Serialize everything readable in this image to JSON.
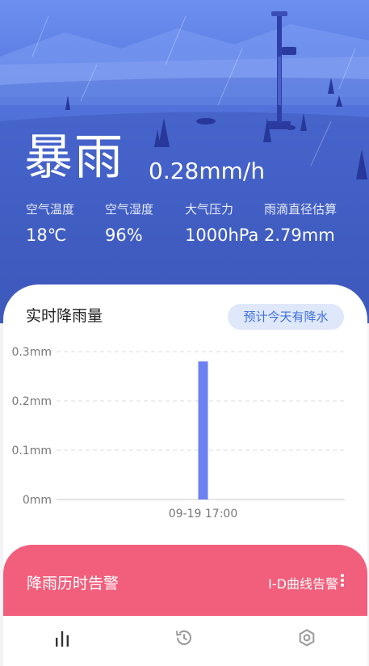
{
  "hero": {
    "weather_title": "暴雨",
    "rain_rate": "0.28mm/h",
    "stats": [
      {
        "label": "空气温度",
        "value": "18℃"
      },
      {
        "label": "空气湿度",
        "value": "96%"
      },
      {
        "label": "大气压力",
        "value": "1000hPa"
      },
      {
        "label": "雨滴直径估算",
        "value": "2.79mm"
      }
    ]
  },
  "rain_card": {
    "title": "实时降雨量",
    "forecast_badge": "预计今天有降水"
  },
  "chart_data": {
    "type": "bar",
    "categories": [
      "09-19 17:00"
    ],
    "values": [
      0.28
    ],
    "title": "",
    "xlabel": "",
    "ylabel": "",
    "ylim": [
      0,
      0.3
    ],
    "yticks": [
      "0mm",
      "0.1mm",
      "0.2mm",
      "0.3mm"
    ],
    "grid": true,
    "bar_color": "#6b82f0"
  },
  "alert": {
    "title": "降雨历时告警",
    "link_label": "I-D曲线告警",
    "color": "#f25f7c"
  },
  "bottom_nav": {
    "items": [
      {
        "icon": "bar-chart-icon"
      },
      {
        "icon": "history-icon"
      },
      {
        "icon": "settings-hexagon-icon"
      }
    ]
  }
}
